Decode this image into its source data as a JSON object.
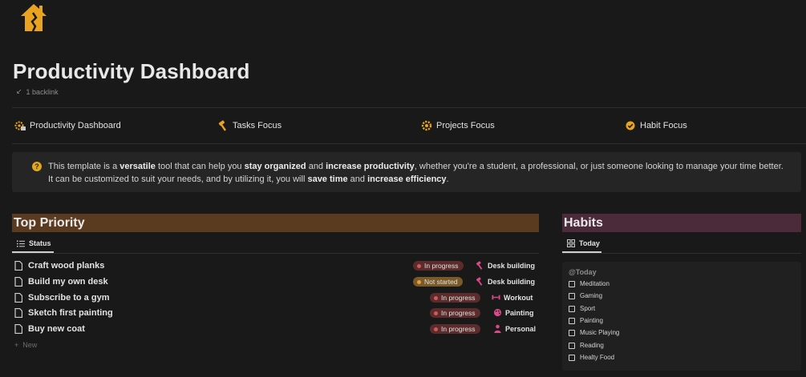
{
  "page": {
    "title": "Productivity Dashboard",
    "backlink": "1 backlink",
    "icon": "house-icon",
    "accent": "#e8a321"
  },
  "nav": [
    {
      "label": "Productivity Dashboard",
      "icon": "dashboard-gear-icon"
    },
    {
      "label": "Tasks Focus",
      "icon": "hammer-icon"
    },
    {
      "label": "Projects Focus",
      "icon": "gear-icon"
    },
    {
      "label": "Habit Focus",
      "icon": "check-circle-icon"
    }
  ],
  "callout": {
    "icon": "question-circle-icon",
    "p1": "This template is a ",
    "b1": "versatile",
    "p2": " tool that can help you ",
    "b2": "stay organized",
    "p3": " and ",
    "b3": "increase productivity",
    "p4": ", whether you're a student, a professional, or just someone looking to manage your time better. It can be customized to suit your needs, and by utilizing it, you will ",
    "b4": "save time",
    "p5": " and ",
    "b5": "increase efficiency",
    "p6": "."
  },
  "top_priority": {
    "title": "Top Priority",
    "view_label": "Status",
    "new_label": "New",
    "tasks": [
      {
        "name": "Craft wood planks",
        "status": "In progress",
        "project": "Desk building",
        "project_icon": "hammer-icon"
      },
      {
        "name": "Build my own desk",
        "status": "Not started",
        "project": "Desk building",
        "project_icon": "hammer-icon"
      },
      {
        "name": "Subscribe to a gym",
        "status": "In progress",
        "project": "Workout",
        "project_icon": "dumbbell-icon"
      },
      {
        "name": "Sketch first painting",
        "status": "In progress",
        "project": "Painting",
        "project_icon": "palette-icon"
      },
      {
        "name": "Buy new coat",
        "status": "In progress",
        "project": "Personal",
        "project_icon": "person-icon"
      }
    ]
  },
  "habits": {
    "title": "Habits",
    "view_label": "Today",
    "group_title": "@Today",
    "items": [
      "Meditation",
      "Gaming",
      "Sport",
      "Painting",
      "Music Playing",
      "Reading",
      "Healty Food"
    ]
  }
}
